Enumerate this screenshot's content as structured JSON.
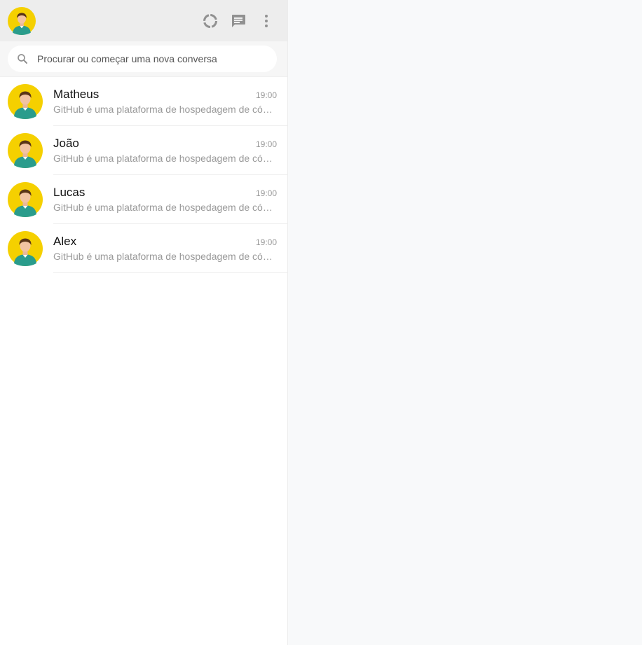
{
  "header": {
    "avatar_icon": "user-avatar-icon",
    "actions": [
      {
        "name": "status-button",
        "icon": "status-ring-icon"
      },
      {
        "name": "new-chat-button",
        "icon": "chat-icon"
      },
      {
        "name": "menu-button",
        "icon": "more-vert-icon"
      }
    ]
  },
  "search": {
    "placeholder": "Procurar ou começar uma nova conversa",
    "value": "",
    "icon": "search-icon"
  },
  "chats": [
    {
      "name": "Matheus",
      "time": "19:00",
      "message": "GitHub é uma plataforma de hospedagem de código-fonte"
    },
    {
      "name": "João",
      "time": "19:00",
      "message": "GitHub é uma plataforma de hospedagem de código-fonte"
    },
    {
      "name": "Lucas",
      "time": "19:00",
      "message": "GitHub é uma plataforma de hospedagem de código-fonte"
    },
    {
      "name": "Alex",
      "time": "19:00",
      "message": "GitHub é uma plataforma de hospedagem de código-fonte"
    }
  ],
  "colors": {
    "avatar_bg": "#f5d000",
    "header_bg": "#ededed",
    "icon_color": "#919191"
  }
}
